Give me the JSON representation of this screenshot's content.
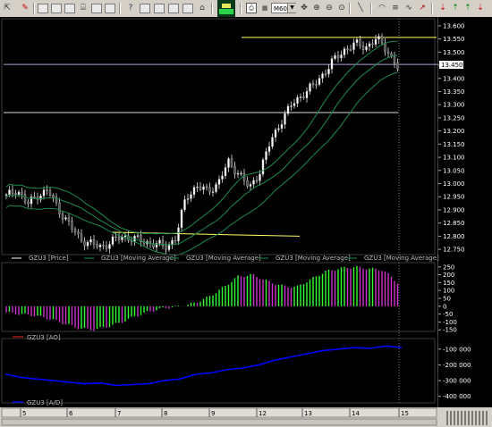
{
  "toolbar": {
    "zoom_value": "M60",
    "zoom_arrow": "▼",
    "icons": [
      "cursor-icon",
      "wizard-icon",
      "window-icon",
      "window-icon",
      "window-icon",
      "window-icon",
      "properties-icon",
      "help-icon",
      "window-icon",
      "window-icon",
      "lock-icon",
      "thumbnail-icon",
      "print-icon",
      "zoom-dropdown",
      "move-icon",
      "zoom-center-icon",
      "zoom-out-icon",
      "zoom-in-icon",
      "line-icon",
      "arc-icon",
      "fibonacci-icon",
      "text-icon",
      "arrow-icon",
      "signal-icon"
    ]
  },
  "price_panel": {
    "y_ticks": [
      "13.600",
      "13.550",
      "13.500",
      "13.450",
      "13.400",
      "13.350",
      "13.300",
      "13.250",
      "13.200",
      "13.150",
      "13.100",
      "13.050",
      "13.000",
      "12.950",
      "12.900",
      "12.850",
      "12.800",
      "12.750"
    ],
    "current_price": "13.450",
    "legend": [
      "GZU3 [Price]",
      "GZU3 [Moving Average]",
      "GZU3 [Moving Average]",
      "GZU3 [Moving Average]",
      "GZU3 [Moving Average]"
    ]
  },
  "ao_panel": {
    "y_ticks": [
      "250",
      "200",
      "150",
      "100",
      "50",
      "0",
      "-50",
      "-100",
      "-150"
    ],
    "legend": "GZU3 [AO]"
  },
  "ad_panel": {
    "y_ticks": [
      "-100 000",
      "-200 000",
      "-300 000",
      "-400 000"
    ],
    "legend": "GZU3 [A/D]"
  },
  "x_axis": {
    "labels": [
      "5",
      "6",
      "7",
      "8",
      "9",
      "12",
      "13",
      "14",
      "15"
    ]
  },
  "colors": {
    "background": "#000000",
    "bull": "#ffffff",
    "ma": "#1e8c4e",
    "yellow": "#ffff66",
    "ao_green": "#33ff33",
    "ao_magenta": "#cc33cc",
    "ad_line": "#0000ff"
  },
  "chart_data": [
    {
      "type": "line",
      "title": "",
      "series": [
        {
          "name": "GZU3 [Price]",
          "values": [
            12.95,
            12.98,
            12.92,
            12.96,
            12.97,
            12.9,
            12.84,
            12.79,
            12.77,
            12.76,
            12.78,
            12.8,
            12.79,
            12.78,
            12.77,
            12.76,
            12.79,
            12.95,
            12.99,
            12.97,
            13.0,
            13.08,
            13.04,
            12.98,
            13.05,
            13.16,
            13.24,
            13.3,
            13.34,
            13.37,
            13.42,
            13.47,
            13.51,
            13.53,
            13.52,
            13.55,
            13.51,
            13.44
          ]
        }
      ],
      "x": [
        "5",
        "6",
        "7",
        "8",
        "9",
        "12",
        "13",
        "14",
        "15"
      ],
      "ylim": [
        12.73,
        13.62
      ]
    },
    {
      "type": "bar",
      "series": [
        {
          "name": "GZU3 [AO]",
          "values": [
            -40,
            -50,
            -60,
            -80,
            -110,
            -140,
            -150,
            -130,
            -100,
            -60,
            -30,
            -10,
            0,
            20,
            60,
            120,
            190,
            200,
            160,
            130,
            120,
            170,
            220,
            240,
            250,
            240,
            230,
            150
          ]
        }
      ],
      "ylim": [
        -160,
        260
      ]
    },
    {
      "type": "line",
      "series": [
        {
          "name": "GZU3 [A/D]",
          "values": [
            -260000,
            -280000,
            -290000,
            -300000,
            -310000,
            -320000,
            -315000,
            -330000,
            -325000,
            -320000,
            -300000,
            -290000,
            -260000,
            -250000,
            -230000,
            -220000,
            -200000,
            -170000,
            -150000,
            -130000,
            -110000,
            -100000,
            -90000,
            -95000,
            -80000,
            -90000
          ]
        }
      ],
      "ylim": [
        -430000,
        -50000
      ]
    }
  ]
}
